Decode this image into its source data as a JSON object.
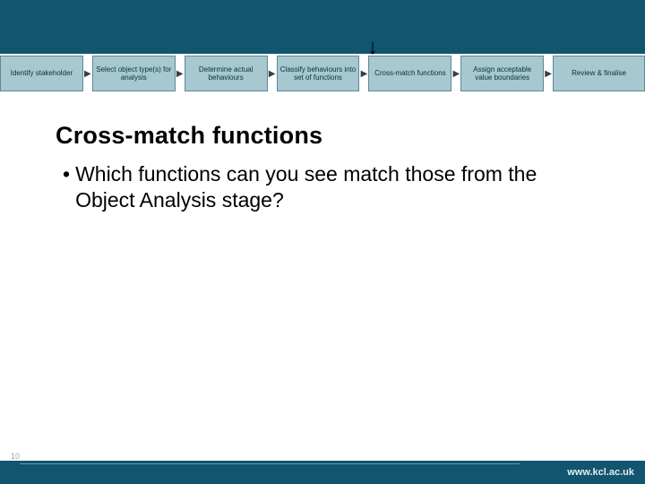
{
  "arrow_indicator": "↓",
  "flow": {
    "items": [
      {
        "label": "Identify stakeholder"
      },
      {
        "label": "Select object type(s) for analysis"
      },
      {
        "label": "Determine actual behaviours"
      },
      {
        "label": "Classify behaviours into set of functions"
      },
      {
        "label": "Cross-match functions"
      },
      {
        "label": "Assign acceptable value boundaries"
      },
      {
        "label": "Review & finalise"
      }
    ],
    "arrow_glyph": "▶"
  },
  "title": "Cross-match functions",
  "bullet": {
    "marker": "•",
    "text": "Which functions can you see match those from the Object Analysis stage?"
  },
  "footer": {
    "page_number": "10",
    "url": "www.kcl.ac.uk"
  },
  "colors": {
    "brand_dark": "#11556f",
    "flow_fill": "#a7c8cf",
    "flow_border": "#5b8a95"
  }
}
